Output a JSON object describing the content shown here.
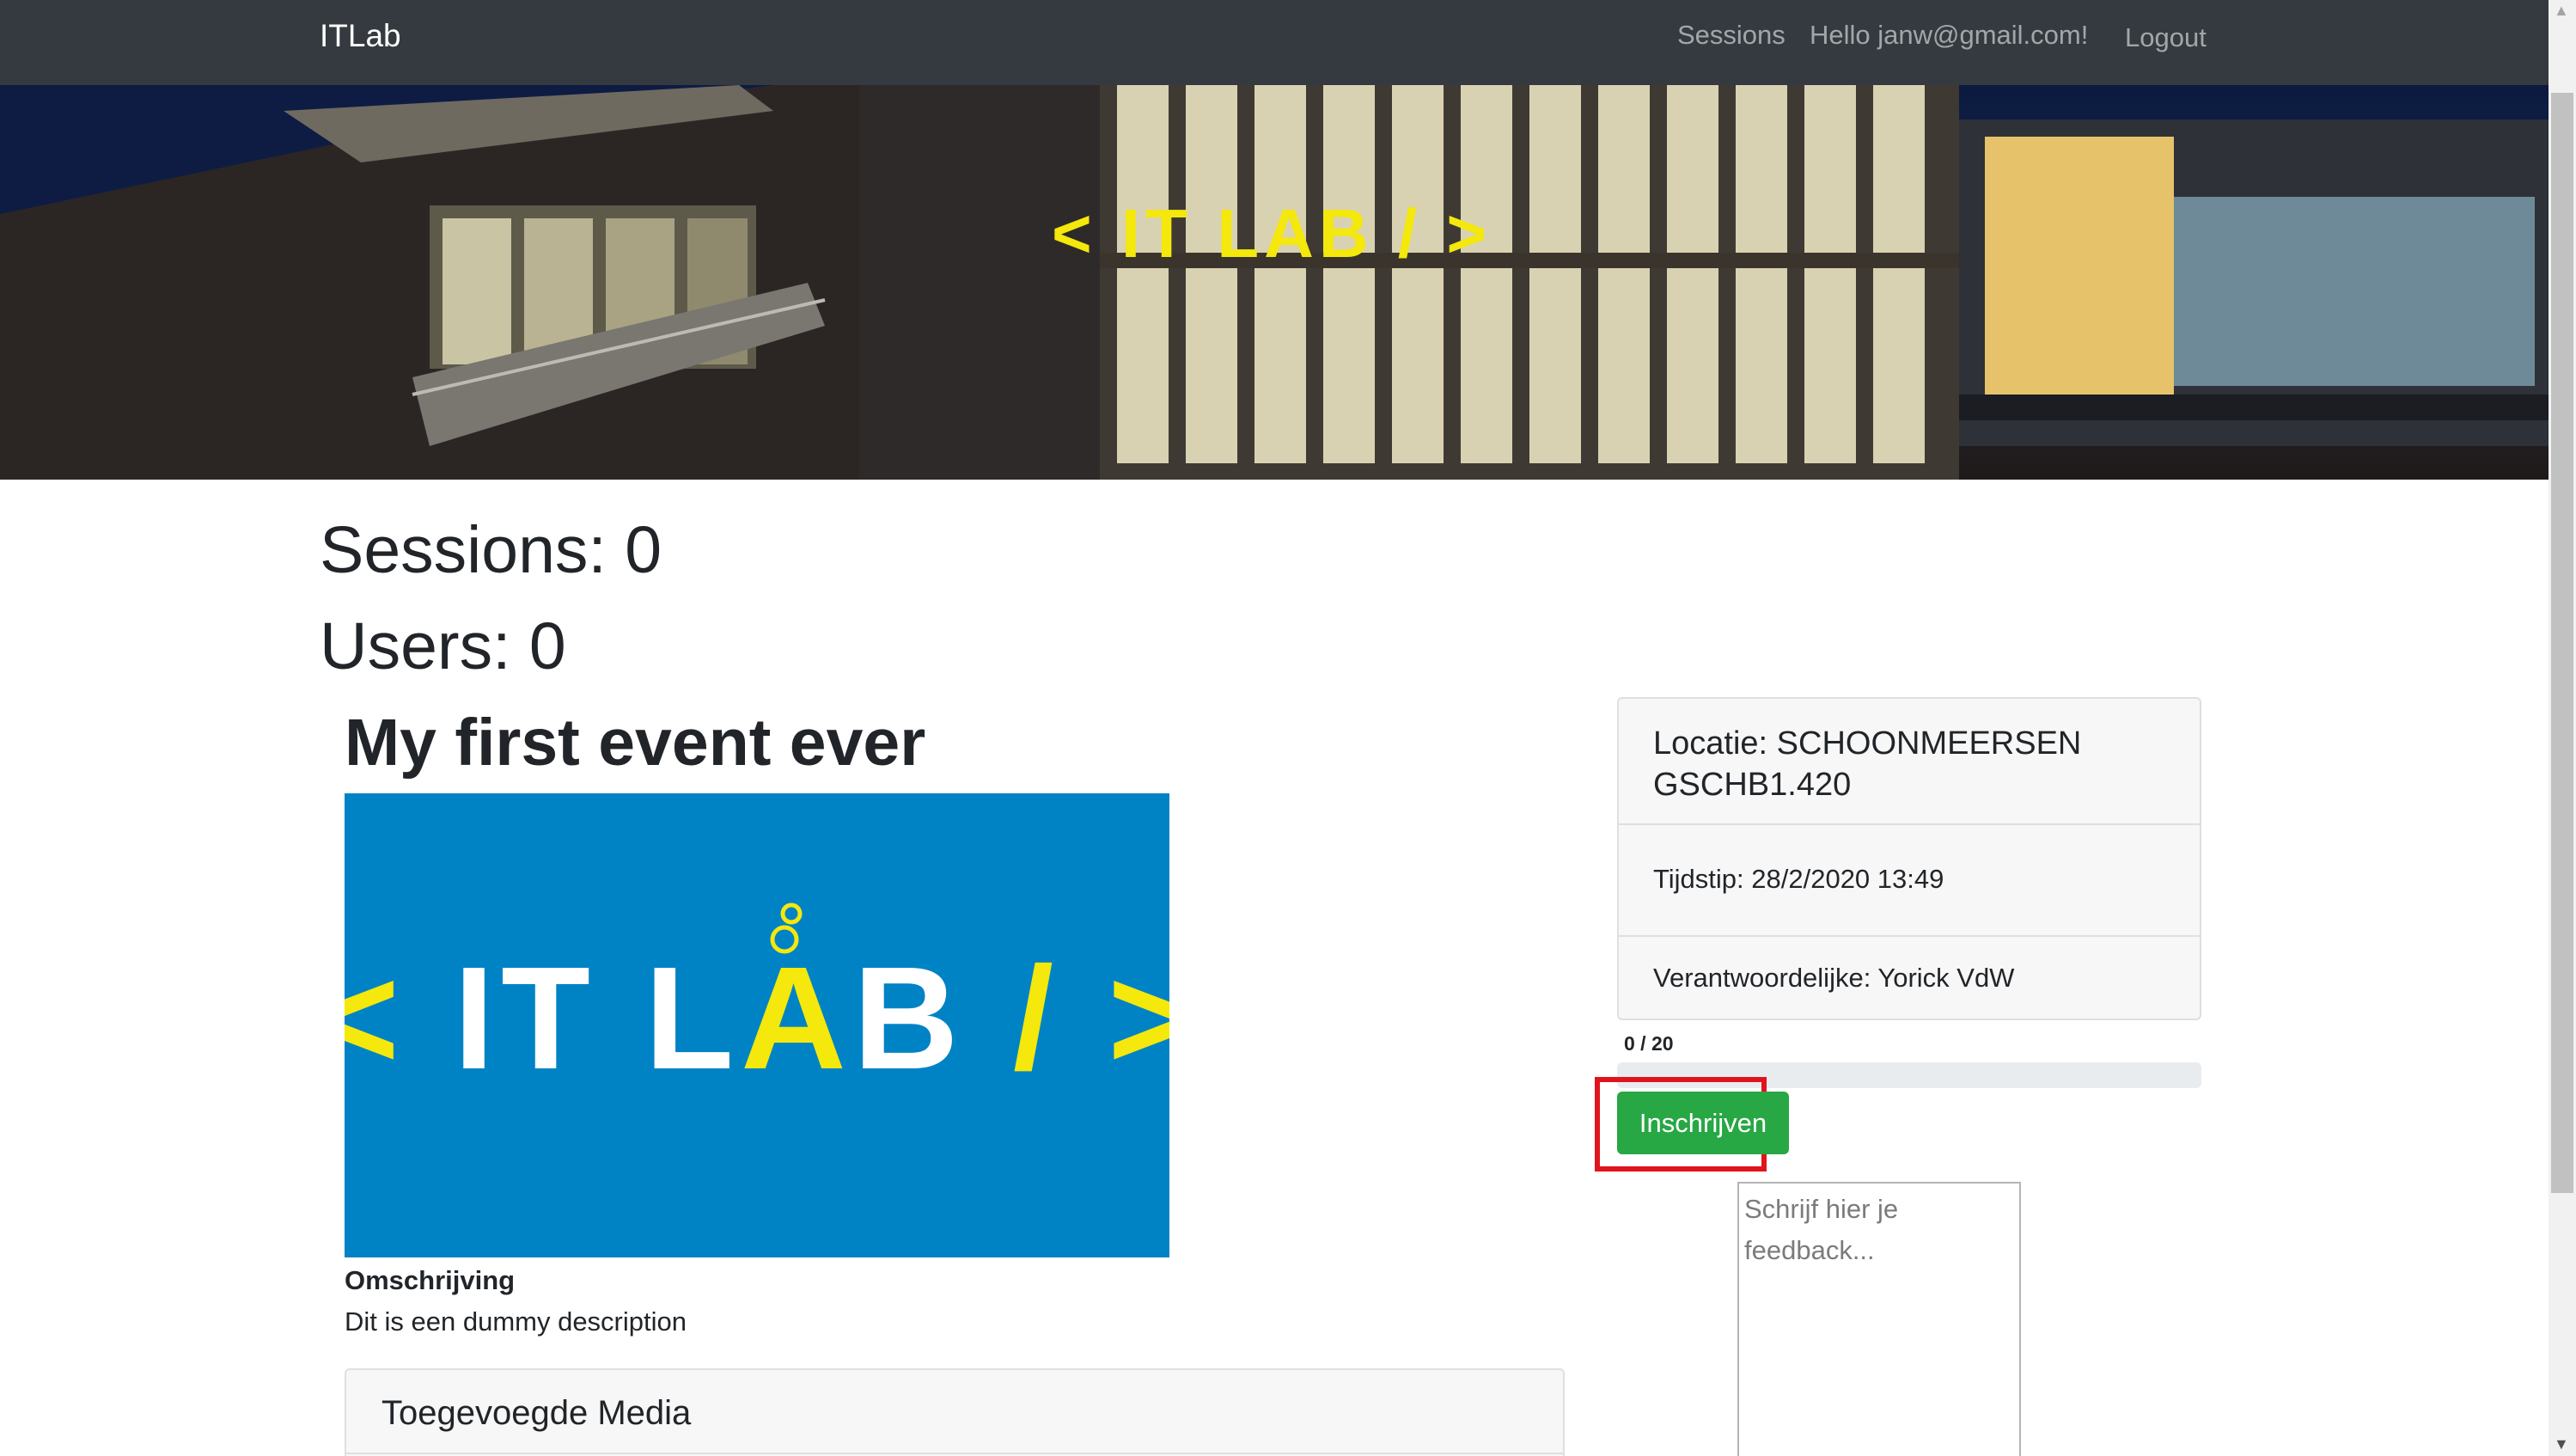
{
  "navbar": {
    "brand": "ITLab",
    "links": {
      "sessions": "Sessions",
      "hello": "Hello janw@gmail.com!",
      "logout": "Logout"
    }
  },
  "hero": {
    "logo_alt": "< IT LAB / >"
  },
  "stats": {
    "sessions": "Sessions: 0",
    "users": "Users: 0"
  },
  "event": {
    "title": "My first event ever",
    "image_logo_alt": "< IT LAB / >",
    "description_label": "Omschrijving",
    "description": "Dit is een dummy description",
    "media_title": "Toegevoegde Media"
  },
  "info": {
    "location": "Locatie: SCHOONMEERSEN GSCHB1.420",
    "time": "Tijdstip: 28/2/2020 13:49",
    "responsible": "Verantwoordelijke: Yorick VdW",
    "capacity_text": "0 / 20",
    "capacity_fraction": 0
  },
  "actions": {
    "subscribe_label": "Inschrijven",
    "feedback_placeholder": "Schrijf hier je feedback..."
  },
  "colors": {
    "navbar": "#343a40",
    "brand_yellow": "#f4e80c",
    "image_blue": "#0083c5",
    "success": "#28a745",
    "highlight": "#e0141c"
  },
  "icons": {
    "scroll_up": "▲",
    "scroll_down": "▼"
  }
}
